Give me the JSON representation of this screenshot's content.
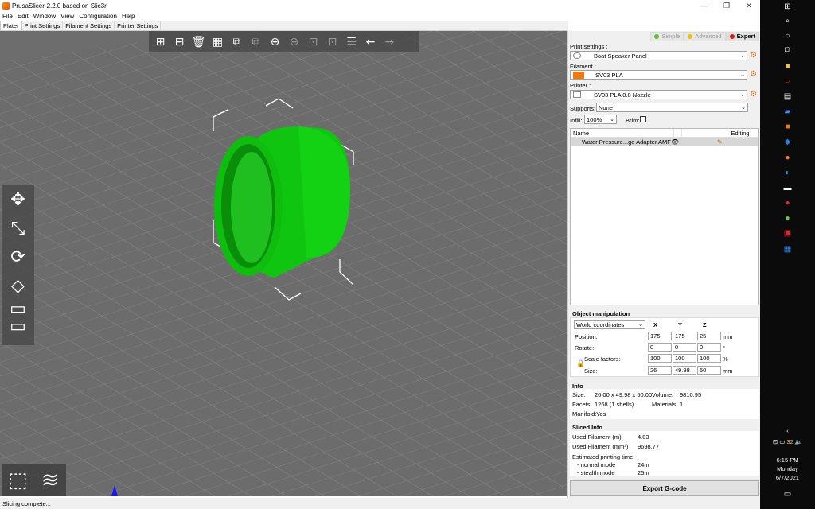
{
  "window": {
    "title": "PrusaSlicer-2.2.0 based on Slic3r",
    "minimize": "—",
    "maximize": "❐",
    "close": "✕"
  },
  "menu": [
    "File",
    "Edit",
    "Window",
    "View",
    "Configuration",
    "Help"
  ],
  "tabs": [
    "Plater",
    "Print Settings",
    "Filament Settings",
    "Printer Settings"
  ],
  "modes": {
    "simple": "Simple",
    "advanced": "Advanced",
    "expert": "Expert",
    "colors": {
      "simple": "#5cbf2a",
      "advanced": "#f2c200",
      "expert": "#d61c1c"
    }
  },
  "print_settings": {
    "label": "Print settings :",
    "value": "Boat Speaker Panel"
  },
  "filament": {
    "label": "Filament :",
    "value": "SV03 PLA",
    "color": "#f07b0b"
  },
  "printer": {
    "label": "Printer :",
    "value": "SV03 PLA 0.8 Nozzle"
  },
  "supports": {
    "label": "Supports:",
    "value": "None"
  },
  "infill": {
    "label": "Infill:",
    "value": "100%"
  },
  "brim": {
    "label": "Brim:"
  },
  "object_list": {
    "col_name": "Name",
    "col_editing": "Editing",
    "items": [
      {
        "name": "Water Pressure...ge Adapter.AMF"
      }
    ]
  },
  "object_manipulation": {
    "title": "Object manipulation",
    "coord_system": "World coordinates",
    "axes": [
      "X",
      "Y",
      "Z"
    ],
    "position": {
      "label": "Position:",
      "values": [
        "175",
        "175",
        "25"
      ],
      "unit": "mm"
    },
    "rotate": {
      "label": "Rotate:",
      "values": [
        "0",
        "0",
        "0"
      ],
      "unit": "°"
    },
    "scale": {
      "label": "Scale factors:",
      "values": [
        "100",
        "100",
        "100"
      ],
      "unit": "%"
    },
    "size": {
      "label": "Size:",
      "values": [
        "26",
        "49.98",
        "50"
      ],
      "unit": "mm"
    }
  },
  "info": {
    "title": "Info",
    "size_label": "Size:",
    "size_value": "26.00 x 49.98 x 50.00",
    "volume_label": "Volume:",
    "volume_value": "9810.95",
    "facets_label": "Facets:",
    "facets_value": "1268 (1 shells)",
    "materials_label": "Materials:",
    "materials_value": "1",
    "manifold_label": "Manifold:",
    "manifold_value": "Yes"
  },
  "sliced_info": {
    "title": "Sliced Info",
    "used_filament_m_label": "Used Filament (m)",
    "used_filament_m_value": "4.03",
    "used_filament_mm3_label": "Used Filament (mm³)",
    "used_filament_mm3_value": "9698.77",
    "est_time_label": "Estimated printing time:",
    "normal_label": "- normal mode",
    "normal_value": "24m",
    "stealth_label": "- stealth mode",
    "stealth_value": "25m"
  },
  "export_button": "Export G-code",
  "status": "Slicing complete...",
  "model_color": "#0fcc0f",
  "taskbar": {
    "time": "6:15 PM",
    "day": "Monday",
    "date": "6/7/2021",
    "temp": "32"
  }
}
